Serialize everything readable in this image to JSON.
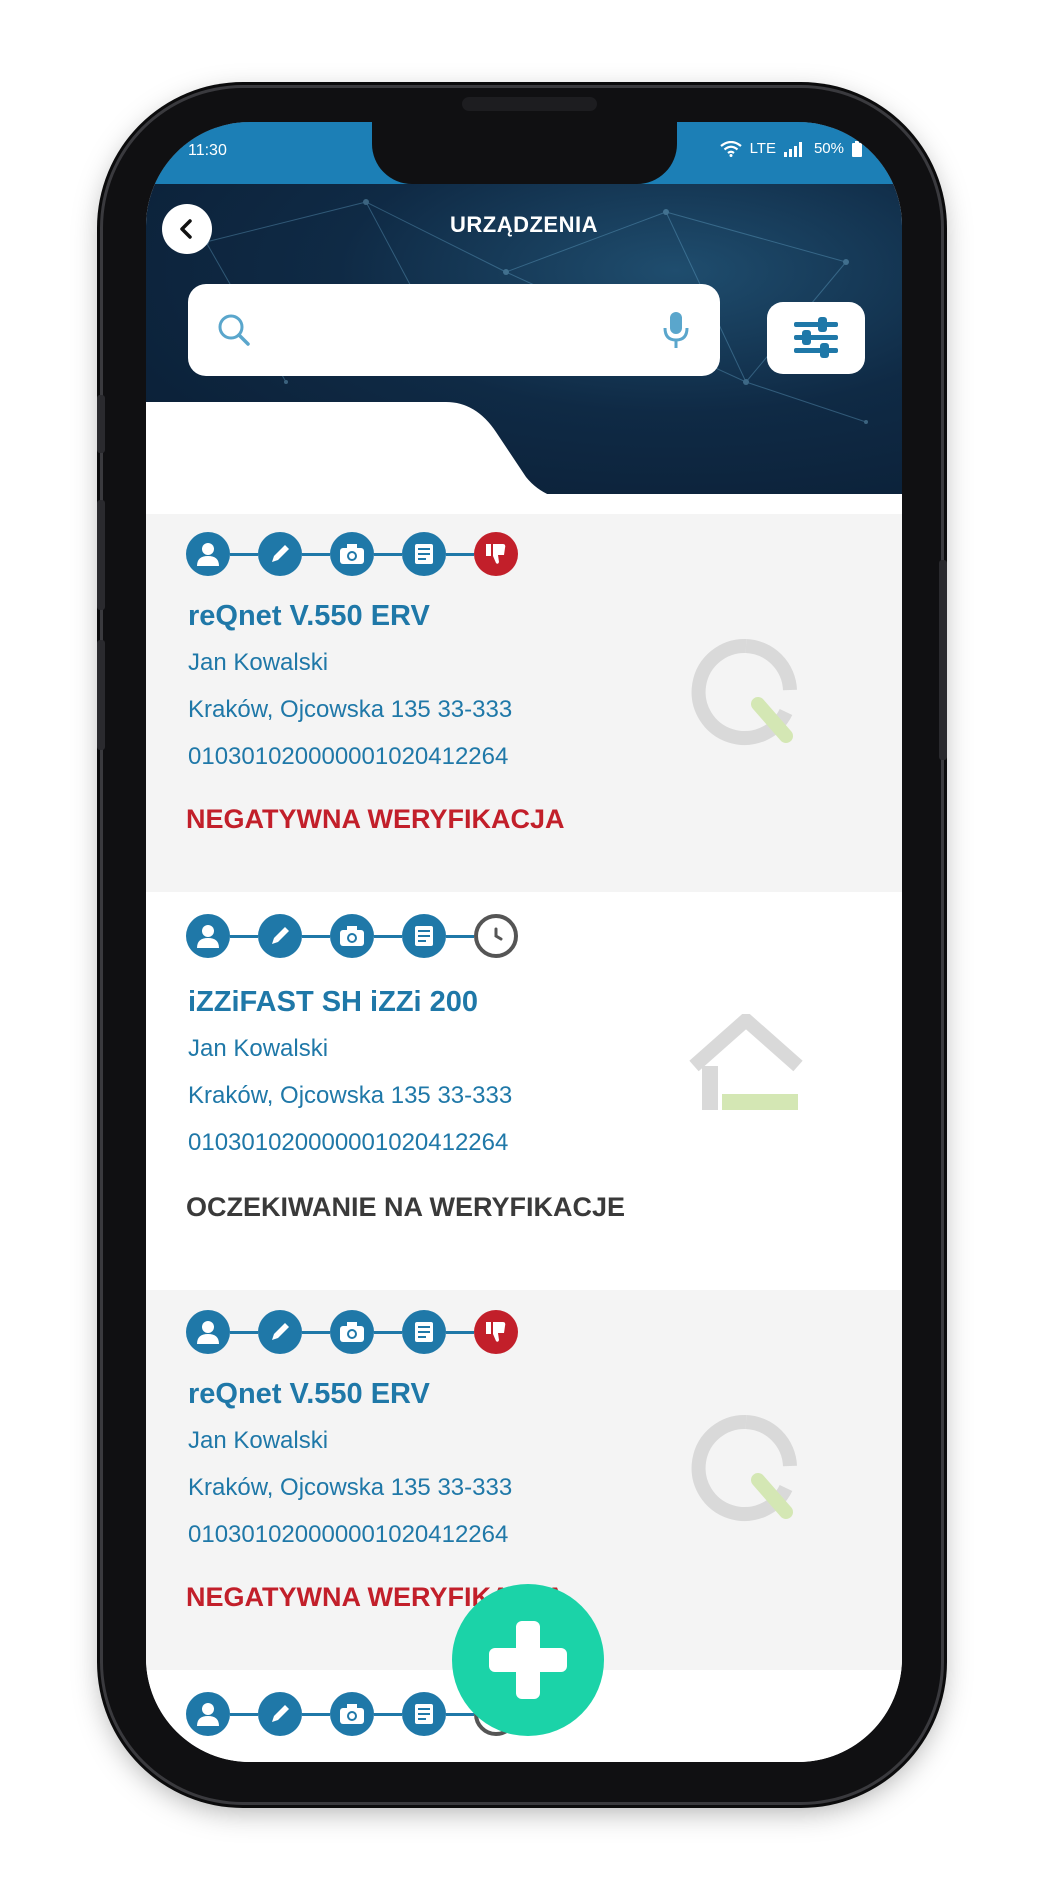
{
  "status_bar": {
    "time": "11:30",
    "network": "LTE",
    "battery": "50%"
  },
  "header": {
    "title": "URZĄDZENIA",
    "search_placeholder": ""
  },
  "devices": [
    {
      "name": "reQnet V.550 ERV",
      "owner": "Jan Kowalski",
      "address": "Kraków, Ojcowska 135 33-333",
      "number": "010301020000001020412264",
      "status": "NEGATYWNA WERYFIKACJA",
      "final_step": "thumbs-down-icon",
      "logo": "reqnet-logo"
    },
    {
      "name": "iZZiFAST SH iZZi 200",
      "owner": "Jan Kowalski",
      "address": "Kraków, Ojcowska 135 33-333",
      "number": "010301020000001020412264",
      "status": "OCZEKIWANIE NA WERYFIKACJE",
      "final_step": "clock-icon",
      "logo": "izzi-house-logo"
    },
    {
      "name": "reQnet V.550 ERV",
      "owner": "Jan Kowalski",
      "address": "Kraków, Ojcowska 135 33-333",
      "number": "010301020000001020412264",
      "status": "NEGATYWNA WERYFIKACJA",
      "final_step": "thumbs-down-icon",
      "logo": "reqnet-logo"
    }
  ],
  "colors": {
    "primary": "#1f78a8",
    "negative": "#c21f2a",
    "fab": "#1bd3a8",
    "header_dark": "#0f2a45"
  }
}
